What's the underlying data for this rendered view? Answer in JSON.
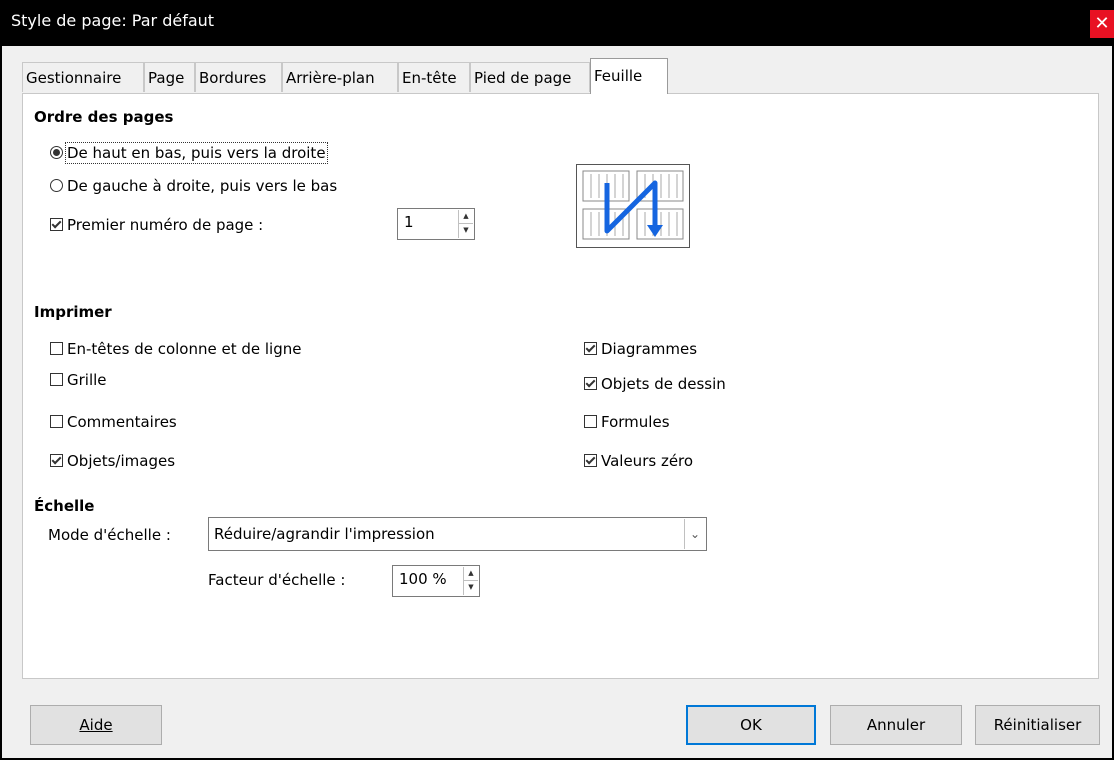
{
  "window": {
    "title": "Style de page: Par défaut",
    "close": "✕"
  },
  "tabs": [
    {
      "label": "Gestionnaire"
    },
    {
      "label": "Page"
    },
    {
      "label": "Bordures"
    },
    {
      "label": "Arrière-plan"
    },
    {
      "label": "En-tête"
    },
    {
      "label": "Pied de page"
    },
    {
      "label": "Feuille",
      "active": true
    }
  ],
  "page_order": {
    "title": "Ordre des pages",
    "top_down": {
      "label": "De haut en bas, puis vers la droite",
      "selected": true
    },
    "left_right": {
      "label": "De gauche à droite, puis vers le bas",
      "selected": false
    },
    "first_page": {
      "label": "Premier numéro de page :",
      "checked": true,
      "value": "1"
    }
  },
  "print": {
    "title": "Imprimer",
    "headers": {
      "label": "En-têtes de colonne et de ligne",
      "checked": false
    },
    "grid": {
      "label": "Grille",
      "checked": false
    },
    "comments": {
      "label": "Commentaires",
      "checked": false
    },
    "objects": {
      "label": "Objets/images",
      "checked": true
    },
    "charts": {
      "label": "Diagrammes",
      "checked": true
    },
    "drawing": {
      "label": "Objets de dessin",
      "checked": true
    },
    "formulas": {
      "label": "Formules",
      "checked": false
    },
    "zero": {
      "label": "Valeurs zéro",
      "checked": true
    }
  },
  "scale": {
    "title": "Échelle",
    "mode_label": "Mode d'échelle :",
    "mode_value": "Réduire/agrandir l'impression",
    "factor_label": "Facteur d'échelle :",
    "factor_value": "100 %"
  },
  "buttons": {
    "help": "Aide",
    "ok": "OK",
    "cancel": "Annuler",
    "reset": "Réinitialiser"
  },
  "colors": {
    "close_bg": "#e81123",
    "default_btn": "#0078d7",
    "arrow": "#1565e0"
  }
}
